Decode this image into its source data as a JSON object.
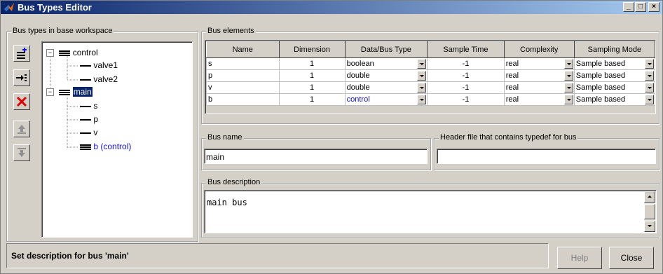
{
  "window": {
    "title": "Bus Types Editor"
  },
  "left_panel": {
    "legend": "Bus types in base workspace",
    "tree": [
      {
        "label": "control",
        "children": [
          "valve1",
          "valve2"
        ]
      },
      {
        "label": "main",
        "children": [
          "s",
          "p",
          "v",
          "b (control)"
        ]
      }
    ]
  },
  "elements": {
    "legend": "Bus elements",
    "columns": [
      "Name",
      "Dimension",
      "Data/Bus Type",
      "Sample Time",
      "Complexity",
      "Sampling Mode"
    ],
    "rows": [
      {
        "name": "s",
        "dimension": "1",
        "type": "boolean",
        "sample_time": "-1",
        "complexity": "real",
        "mode": "Sample based"
      },
      {
        "name": "p",
        "dimension": "1",
        "type": "double",
        "sample_time": "-1",
        "complexity": "real",
        "mode": "Sample based"
      },
      {
        "name": "v",
        "dimension": "1",
        "type": "double",
        "sample_time": "-1",
        "complexity": "real",
        "mode": "Sample based"
      },
      {
        "name": "b",
        "dimension": "1",
        "type": "control",
        "sample_time": "-1",
        "complexity": "real",
        "mode": "Sample based"
      }
    ]
  },
  "bus_name": {
    "legend": "Bus name",
    "value": "main"
  },
  "header_file": {
    "legend": "Header file that contains typedef for bus",
    "value": ""
  },
  "description": {
    "legend": "Bus description",
    "value": "main bus"
  },
  "status": "Set description for bus 'main'",
  "buttons": {
    "help": "Help",
    "close": "Close"
  },
  "colors": {
    "title_start": "#0a246a",
    "title_end": "#a6caf0",
    "bus_type_link": "#1010e0",
    "delete_icon": "#e00000"
  }
}
